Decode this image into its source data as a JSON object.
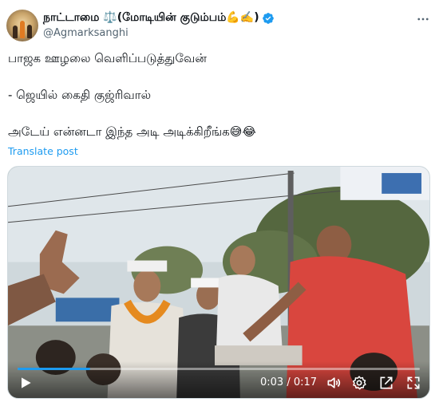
{
  "post": {
    "display_name": "நாட்டாமை ⚖️(மோடியின் குடும்பம்💪✍️)",
    "handle": "@Agmarksanghi",
    "text_lines": [
      "பாஜக ஊழலை வெளிப்படுத்துவேன்",
      "- ஜெயில் கைதி குஜ்ரிவால்",
      "அடேய் என்னடா இந்த அடி அடிக்கிறீங்க😅😂"
    ],
    "translate_label": "Translate post"
  },
  "video": {
    "current_time": "0:03",
    "separator": "/",
    "duration": "0:17",
    "progress_fraction": 0.18
  },
  "colors": {
    "accent": "#1d9bf0",
    "secondary_text": "#536471"
  },
  "icons": {
    "more": "more-options-icon",
    "verified": "verified-badge-icon",
    "play": "play-icon",
    "volume": "volume-icon",
    "settings": "settings-icon",
    "popout": "popout-icon",
    "fullscreen": "fullscreen-icon"
  }
}
